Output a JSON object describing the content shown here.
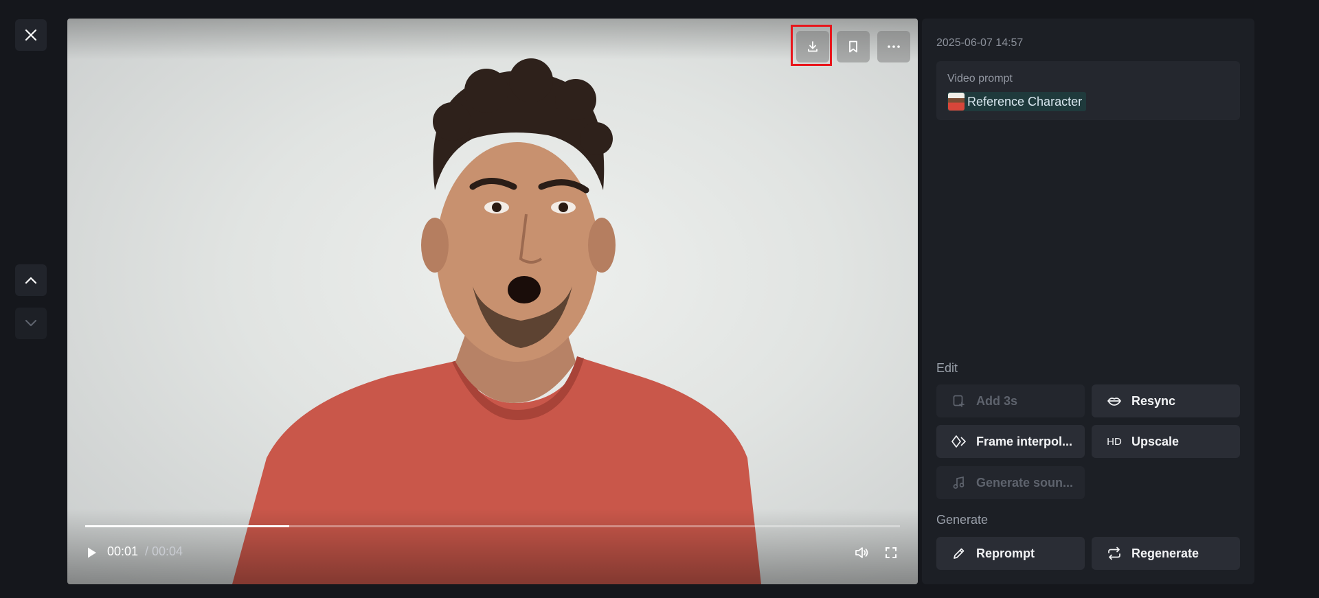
{
  "video": {
    "current_time": "00:01",
    "duration": "/ 00:04",
    "progress": 0.25
  },
  "panel": {
    "date": "2025-06-07 14:57",
    "prompt_label": "Video prompt",
    "chip_label": "Reference Character",
    "edit_title": "Edit",
    "generate_title": "Generate",
    "actions": {
      "add": "Add 3s",
      "resync": "Resync",
      "frame": "Frame interpol...",
      "upscale": "Upscale",
      "upscale_tag": "HD",
      "sound": "Generate soun...",
      "reprompt": "Reprompt",
      "regenerate": "Regenerate"
    }
  },
  "colors": {
    "background": "#15171c",
    "panel": "#1c1f25",
    "highlight": "#e8151b",
    "chip": "#1f3a3c"
  },
  "icons": [
    "close-icon",
    "chevron-up-icon",
    "chevron-down-icon",
    "download-icon",
    "bookmark-icon",
    "more-icon",
    "play-icon",
    "volume-icon",
    "fullscreen-icon",
    "add-clip-icon",
    "lips-icon",
    "diamond-icon",
    "music-icon",
    "pencil-icon",
    "repeat-icon"
  ]
}
